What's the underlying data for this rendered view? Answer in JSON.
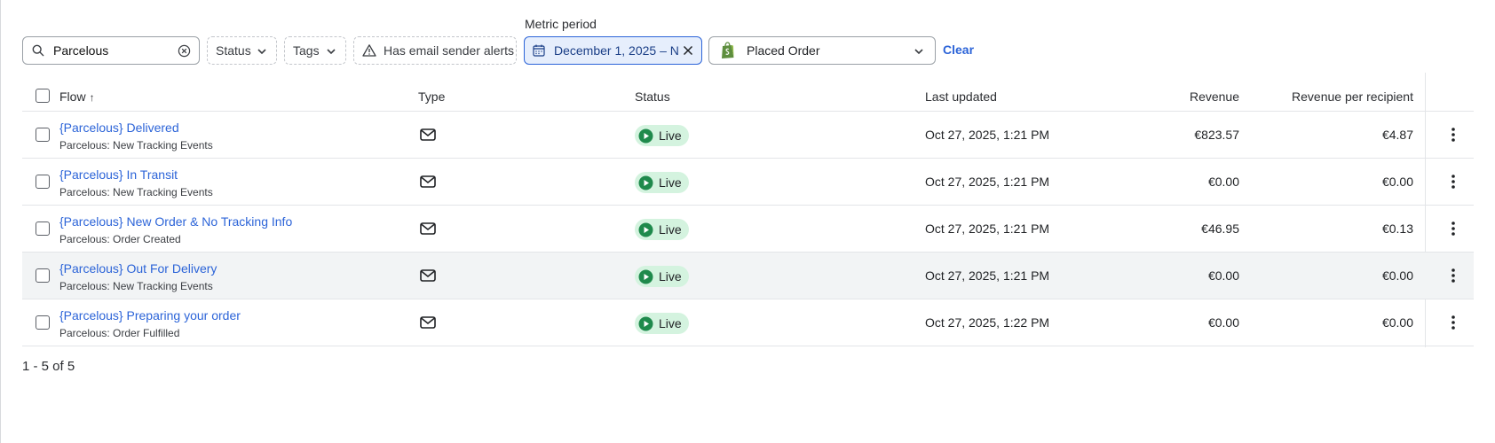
{
  "filters": {
    "metric_period_label": "Metric period",
    "search_value": "Parcelous",
    "status_label": "Status",
    "tags_label": "Tags",
    "alerts_label": "Has email sender alerts",
    "date_range": "December 1, 2025 – N",
    "metric": "Placed Order",
    "clear_label": "Clear"
  },
  "table": {
    "headers": {
      "flow": "Flow",
      "sort_indicator": "↑",
      "type": "Type",
      "status": "Status",
      "last_updated": "Last updated",
      "revenue": "Revenue",
      "revenue_per_recipient": "Revenue per recipient"
    },
    "rows": [
      {
        "name": "{Parcelous} Delivered",
        "trigger": "Parcelous: New Tracking Events",
        "type_icon": "email-icon",
        "status": "Live",
        "last_updated": "Oct 27, 2025, 1:21 PM",
        "revenue": "€823.57",
        "rpr": "€4.87"
      },
      {
        "name": "{Parcelous} In Transit",
        "trigger": "Parcelous: New Tracking Events",
        "type_icon": "email-icon",
        "status": "Live",
        "last_updated": "Oct 27, 2025, 1:21 PM",
        "revenue": "€0.00",
        "rpr": "€0.00"
      },
      {
        "name": "{Parcelous} New Order & No Tracking Info",
        "trigger": "Parcelous: Order Created",
        "type_icon": "email-icon",
        "status": "Live",
        "last_updated": "Oct 27, 2025, 1:21 PM",
        "revenue": "€46.95",
        "rpr": "€0.13"
      },
      {
        "name": "{Parcelous} Out For Delivery",
        "trigger": "Parcelous: New Tracking Events",
        "type_icon": "email-icon",
        "status": "Live",
        "last_updated": "Oct 27, 2025, 1:21 PM",
        "revenue": "€0.00",
        "rpr": "€0.00"
      },
      {
        "name": "{Parcelous} Preparing your order",
        "trigger": "Parcelous: Order Fulfilled",
        "type_icon": "email-icon",
        "status": "Live",
        "last_updated": "Oct 27, 2025, 1:22 PM",
        "revenue": "€0.00",
        "rpr": "€0.00"
      }
    ]
  },
  "pagination": {
    "text": "1 - 5 of 5"
  },
  "colors": {
    "link": "#2c64d8",
    "live_bg": "#d4f3df",
    "live_icon": "#1f8a4c",
    "date_chip_bg": "#e6eefc",
    "row_highlight": "#f2f4f5"
  }
}
